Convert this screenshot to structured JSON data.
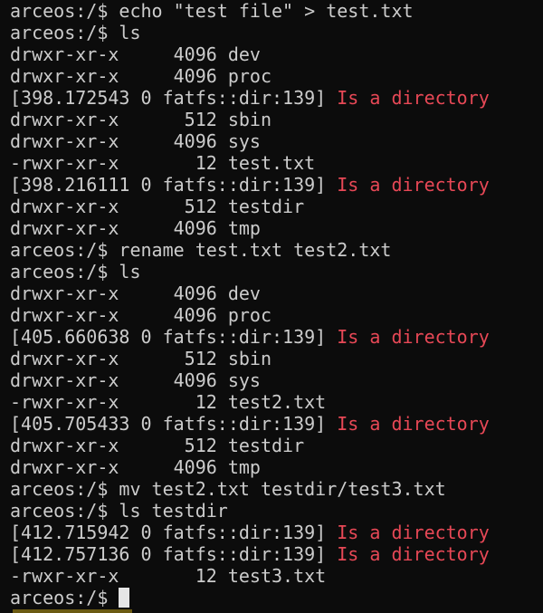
{
  "terminal": {
    "lines": [
      {
        "type": "cmd",
        "prompt": "arceos:/$ ",
        "command": "echo \"test file\" > test.txt"
      },
      {
        "type": "cmd",
        "prompt": "arceos:/$ ",
        "command": "ls"
      },
      {
        "type": "out",
        "text": "drwxr-xr-x     4096 dev"
      },
      {
        "type": "out",
        "text": "drwxr-xr-x     4096 proc"
      },
      {
        "type": "log",
        "prefix": "[398.172543 0 fatfs::dir:139] ",
        "message": "Is a directory"
      },
      {
        "type": "out",
        "text": "drwxr-xr-x      512 sbin"
      },
      {
        "type": "out",
        "text": "drwxr-xr-x     4096 sys"
      },
      {
        "type": "out",
        "text": "-rwxr-xr-x       12 test.txt"
      },
      {
        "type": "log",
        "prefix": "[398.216111 0 fatfs::dir:139] ",
        "message": "Is a directory"
      },
      {
        "type": "out",
        "text": "drwxr-xr-x      512 testdir"
      },
      {
        "type": "out",
        "text": "drwxr-xr-x     4096 tmp"
      },
      {
        "type": "cmd",
        "prompt": "arceos:/$ ",
        "command": "rename test.txt test2.txt"
      },
      {
        "type": "cmd",
        "prompt": "arceos:/$ ",
        "command": "ls"
      },
      {
        "type": "out",
        "text": "drwxr-xr-x     4096 dev"
      },
      {
        "type": "out",
        "text": "drwxr-xr-x     4096 proc"
      },
      {
        "type": "log",
        "prefix": "[405.660638 0 fatfs::dir:139] ",
        "message": "Is a directory"
      },
      {
        "type": "out",
        "text": "drwxr-xr-x      512 sbin"
      },
      {
        "type": "out",
        "text": "drwxr-xr-x     4096 sys"
      },
      {
        "type": "out",
        "text": "-rwxr-xr-x       12 test2.txt"
      },
      {
        "type": "log",
        "prefix": "[405.705433 0 fatfs::dir:139] ",
        "message": "Is a directory"
      },
      {
        "type": "out",
        "text": "drwxr-xr-x      512 testdir"
      },
      {
        "type": "out",
        "text": "drwxr-xr-x     4096 tmp"
      },
      {
        "type": "cmd",
        "prompt": "arceos:/$ ",
        "command": "mv test2.txt testdir/test3.txt"
      },
      {
        "type": "cmd",
        "prompt": "arceos:/$ ",
        "command": "ls testdir"
      },
      {
        "type": "log",
        "prefix": "[412.715942 0 fatfs::dir:139] ",
        "message": "Is a directory"
      },
      {
        "type": "log",
        "prefix": "[412.757136 0 fatfs::dir:139] ",
        "message": "Is a directory"
      },
      {
        "type": "out",
        "text": "-rwxr-xr-x       12 test3.txt"
      }
    ],
    "current_prompt": "arceos:/$"
  },
  "colors": {
    "background": "#0c0c0c",
    "foreground": "#cccccc",
    "error": "#e74856",
    "cursor": "#e6e6e6"
  }
}
